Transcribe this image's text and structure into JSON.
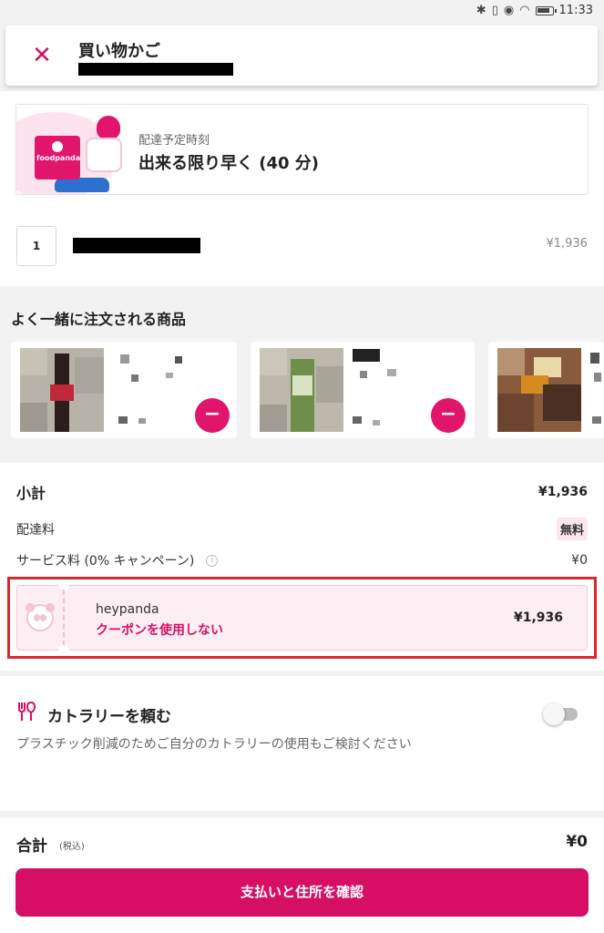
{
  "status_bar": {
    "time": "11:33",
    "icons": [
      "bluetooth-icon",
      "vibrate-icon",
      "eye-icon",
      "wifi-icon",
      "battery-icon"
    ]
  },
  "header": {
    "title": "買い物かご",
    "close_icon": "close-icon"
  },
  "delivery": {
    "label": "配達予定時刻",
    "value": "出来る限り早く (40 分)",
    "brand": "foodpanda"
  },
  "cart": {
    "items": [
      {
        "qty": "1",
        "price": "¥1,936"
      }
    ]
  },
  "recommendations": {
    "title": "よく一緒に注文される商品"
  },
  "summary": {
    "subtotal_label": "小計",
    "subtotal_value": "¥1,936",
    "delivery_fee_label": "配達料",
    "delivery_fee_value": "無料",
    "service_fee_label": "サービス料 (0% キャンペーン)",
    "service_fee_value": "¥0",
    "coupon": {
      "name": "heypanda",
      "action": "クーポンを使用しない",
      "value": "¥1,936"
    }
  },
  "cutlery": {
    "title": "カトラリーを頼む",
    "description": "プラスチック削減のためご自分のカトラリーの使用もご検討ください",
    "enabled": false
  },
  "footer": {
    "total_label": "合計",
    "total_tax_note": "(税込)",
    "total_value": "¥0",
    "pay_button": "支払いと住所を確認"
  },
  "colors": {
    "brand": "#d70f64",
    "highlight_outline": "#d9262f",
    "coupon_bg": "#fdeef4"
  }
}
